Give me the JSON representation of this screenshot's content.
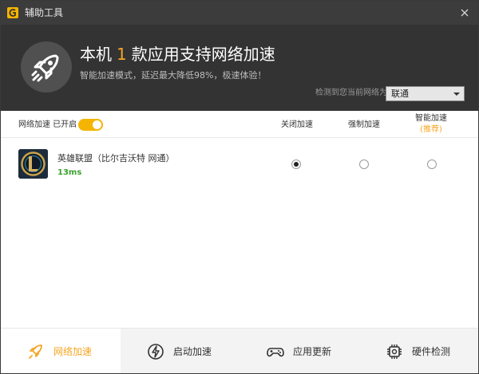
{
  "window": {
    "title": "辅助工具"
  },
  "hero": {
    "title_prefix": "本机",
    "count": "1",
    "title_suffix": "款应用支持网络加速",
    "subtitle": "智能加速模式，延迟最大降低98%，极速体验！",
    "detect_label": "检测到您当前网络为",
    "network_selected": "联通"
  },
  "table": {
    "toggle_label": "网络加速 已开启",
    "toggle_on": true,
    "columns": {
      "off": "关闭加速",
      "force": "强制加速",
      "smart": "智能加速",
      "smart_recommend": "(推荐)"
    },
    "rows": [
      {
        "name": "英雄联盟（比尔吉沃特 网通）",
        "ping": "13ms",
        "mode": "off"
      }
    ]
  },
  "bottom_nav": [
    {
      "label": "网络加速",
      "icon": "rocket-icon",
      "active": true
    },
    {
      "label": "启动加速",
      "icon": "lightning-icon",
      "active": false
    },
    {
      "label": "应用更新",
      "icon": "gamepad-icon",
      "active": false
    },
    {
      "label": "硬件检测",
      "icon": "chip-icon",
      "active": false
    }
  ],
  "colors": {
    "accent": "#f5a623",
    "hero_bg": "#333333",
    "titlebar_bg": "#3c3c3c",
    "ping_green": "#3aa02e"
  }
}
